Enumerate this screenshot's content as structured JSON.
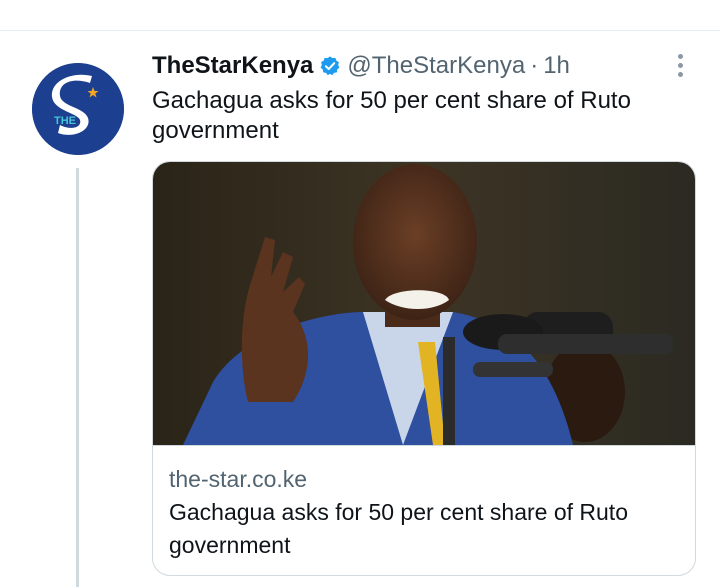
{
  "tweet": {
    "author_name": "TheStarKenya",
    "handle": "@TheStarKenya",
    "separator": "·",
    "time": "1h",
    "text": "Gachagua asks for 50 per cent share of Ruto government",
    "avatar_text": "THE",
    "verified_icon": "verified-badge-icon",
    "more_icon": "more-options-icon"
  },
  "card": {
    "domain": "the-star.co.ke",
    "title": "Gachagua asks for 50 per cent share of Ruto government",
    "image_description": "man-in-blue-suit-speaking-at-microphones"
  },
  "colors": {
    "accent": "#1d9bf0",
    "avatar_bg": "#1d3f8f",
    "secondary_text": "#536471",
    "primary_text": "#0f1419"
  }
}
